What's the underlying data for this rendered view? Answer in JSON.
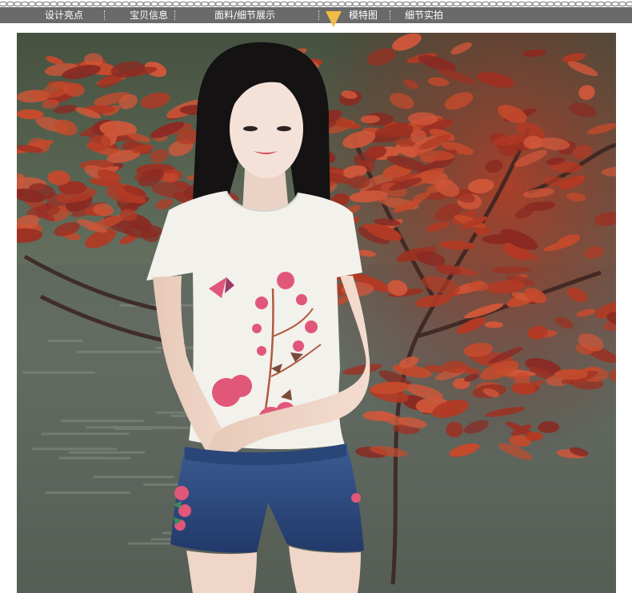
{
  "nav": {
    "items": [
      {
        "label": "设计亮点"
      },
      {
        "label": "宝贝信息"
      },
      {
        "label": "面料/细节展示"
      },
      {
        "label": "模特图"
      },
      {
        "label": "细节实拍"
      }
    ],
    "active_index": 3,
    "colors": {
      "bar": "#6a6a6a",
      "text": "#ffffff",
      "marker": "#f3bb46",
      "chain": "#8a8a8a"
    }
  },
  "photo": {
    "subject": "model-photo",
    "colors": {
      "foliage": "#b23a24",
      "water": "#59625a",
      "shirt": "#f3f1ec",
      "denim": "#2c4a7e",
      "hair": "#141212",
      "embroidery": "#e0577a"
    }
  }
}
